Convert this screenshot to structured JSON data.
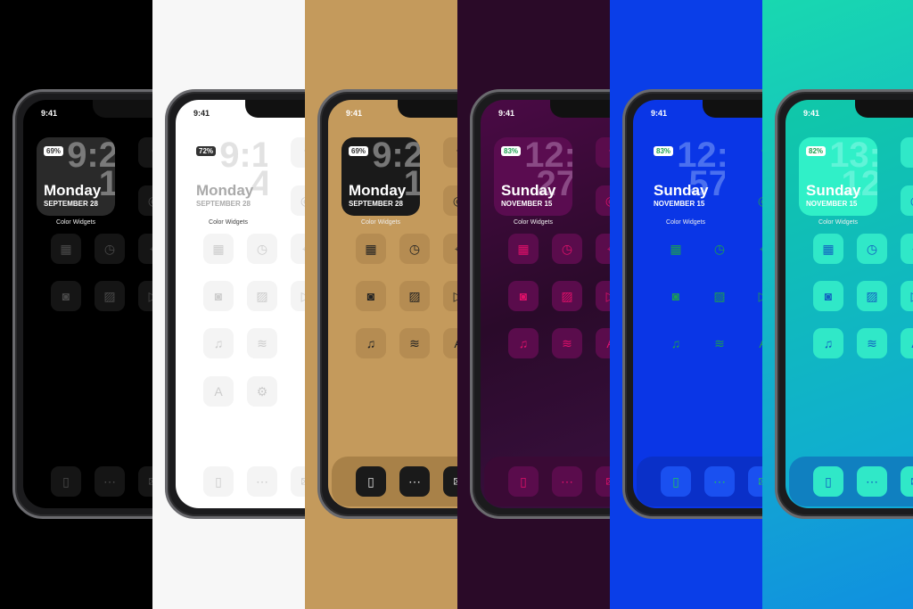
{
  "status_time": "9:41",
  "widget_label": "Color Widgets",
  "panels": [
    {
      "theme": "black",
      "battery": "69%",
      "clock": "9:21",
      "day": "Monday",
      "date": "SEPTEMBER 28",
      "colors": {
        "bg": "#000000",
        "screen": "#000000",
        "tile": "#151515",
        "icon": "#4a4a4a",
        "widget": "#2a2a2a",
        "text": "#ffffff",
        "clock": "#7a7a7a",
        "batt_text": "#333333",
        "dock": "transparent",
        "dock_tile": "#151515",
        "dock_icon": "#4a4a4a"
      },
      "icons": [
        [
          "facebook"
        ],
        [
          "instagram"
        ],
        [
          "calendar",
          "clock",
          "maps"
        ],
        [
          "camera",
          "photos",
          "youtube"
        ]
      ],
      "dock": [
        "phone",
        "messages",
        "mail"
      ]
    },
    {
      "theme": "white",
      "battery": "72%",
      "clock": "9:14",
      "day": "Monday",
      "date": "SEPTEMBER 28",
      "colors": {
        "bg": "#f7f7f7",
        "screen": "#ffffff",
        "tile": "#f4f4f4",
        "icon": "#cccccc",
        "widget": "transparent",
        "text": "#aaaaaa",
        "clock": "#e2e2e2",
        "batt_text": "#ffffff",
        "batt_bg": "#333333",
        "dock": "transparent",
        "dock_tile": "#f4f4f4",
        "dock_icon": "#cccccc"
      },
      "icons": [
        [
          "facebook"
        ],
        [
          "instagram"
        ],
        [
          "calendar",
          "clock",
          "maps"
        ],
        [
          "camera",
          "photos",
          "youtube"
        ],
        [
          "music",
          "spotify"
        ],
        [
          "appstore",
          "settings"
        ]
      ],
      "dock": [
        "phone",
        "messages",
        "mail"
      ]
    },
    {
      "theme": "gold",
      "battery": "69%",
      "clock": "9:21",
      "day": "Monday",
      "date": "SEPTEMBER 28",
      "colors": {
        "bg": "#c49a5c",
        "screen": "#c49a5c",
        "tile": "#b58c52",
        "icon": "#222222",
        "widget": "#1a1a1a",
        "text": "#ffffff",
        "clock": "#777777",
        "batt_text": "#333333",
        "dock": "#a88148",
        "dock_tile": "#1a1a1a",
        "dock_icon": "#dddddd"
      },
      "icons": [
        [
          "facebook"
        ],
        [
          "instagram"
        ],
        [
          "calendar",
          "clock",
          "maps"
        ],
        [
          "camera",
          "photos",
          "youtube"
        ],
        [
          "music",
          "spotify",
          "appstore"
        ]
      ],
      "dock": [
        "phone",
        "messages",
        "mail"
      ]
    },
    {
      "theme": "purple",
      "battery": "83%",
      "clock": "12:27",
      "day": "Sunday",
      "date": "NOVEMBER 15",
      "colors": {
        "bg": "#2a0a28",
        "screen": "linear-gradient(160deg,#4a0a45,#2a0a2a 50%,#3a1040)",
        "tile": "#5a0c4c",
        "icon": "#e0106a",
        "widget": "#5a0c50",
        "text": "#ffffff",
        "clock": "#8a4a85",
        "batt_text": "#1ca050",
        "dock": "#3a0a35",
        "dock_tile": "#5a0c4c",
        "dock_icon": "#e0106a"
      },
      "icons": [
        [
          "facebook"
        ],
        [
          "instagram"
        ],
        [
          "calendar",
          "clock",
          "maps"
        ],
        [
          "camera",
          "photos",
          "youtube"
        ],
        [
          "music",
          "spotify",
          "appstore"
        ]
      ],
      "dock": [
        "phone",
        "messages",
        "mail"
      ]
    },
    {
      "theme": "blue",
      "battery": "83%",
      "clock": "12:57",
      "day": "Sunday",
      "date": "NOVEMBER 15",
      "colors": {
        "bg": "#0a3ee8",
        "screen": "#0a36e6",
        "tile": "transparent",
        "icon": "#1ca050",
        "widget": "transparent",
        "text": "#ffffff",
        "clock": "#4a70f0",
        "batt_text": "#1ca050",
        "dock": "#0a30c8",
        "dock_tile": "#1a50f0",
        "dock_icon": "#20c060"
      },
      "icons": [
        [
          "facebook"
        ],
        [
          "instagram"
        ],
        [
          "calendar",
          "clock",
          "maps"
        ],
        [
          "camera",
          "photos",
          "youtube"
        ],
        [
          "music",
          "spotify",
          "appstore"
        ]
      ],
      "dock": [
        "phone",
        "messages",
        "mail"
      ]
    },
    {
      "theme": "teal",
      "battery": "82%",
      "clock": "13:12",
      "day": "Sunday",
      "date": "NOVEMBER 15",
      "colors": {
        "bg": "linear-gradient(160deg,#18d8b0,#1090e0)",
        "screen": "linear-gradient(160deg,#10c8a8,#10a8d8)",
        "tile": "#30e8c8",
        "icon": "#1060c0",
        "widget": "#30f0c8",
        "text": "#ffffff",
        "clock": "#60f4d8",
        "batt_text": "#1ca050",
        "dock": "#1080c0",
        "dock_tile": "#30e8c8",
        "dock_icon": "#1060c0"
      },
      "icons": [
        [
          "facebook"
        ],
        [
          "instagram"
        ],
        [
          "calendar",
          "clock",
          "maps"
        ],
        [
          "camera",
          "photos",
          "youtube"
        ],
        [
          "music",
          "spotify",
          "appstore"
        ]
      ],
      "dock": [
        "phone",
        "messages",
        "mail"
      ]
    }
  ]
}
